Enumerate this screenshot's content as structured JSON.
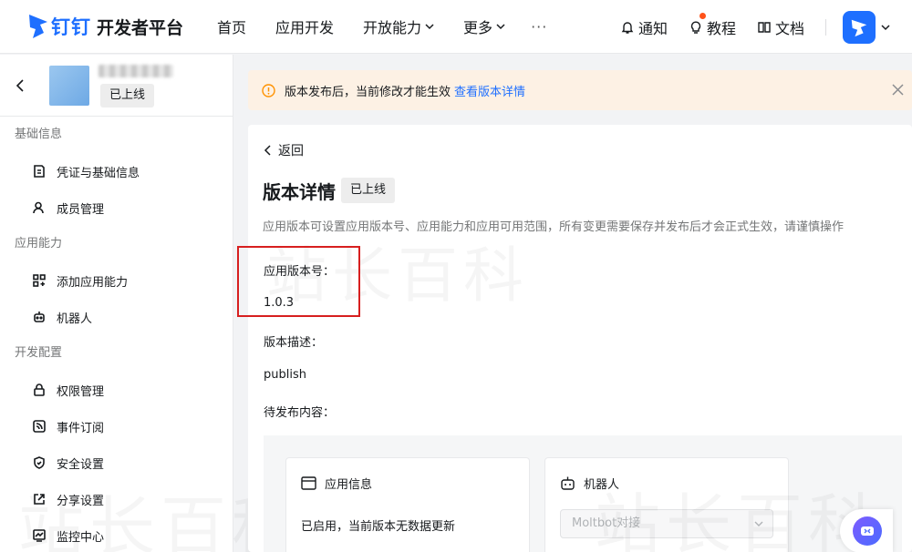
{
  "header": {
    "brand": "钉钉",
    "platform": "开发者平台",
    "nav": [
      "首页",
      "应用开发",
      "开放能力",
      "更多"
    ],
    "more_dots": "···",
    "notify": "通知",
    "tutorial": "教程",
    "docs": "文档",
    "brand_color": "#1e6fff"
  },
  "sidebar": {
    "app_status": "已上线",
    "groups": [
      {
        "title": "基础信息",
        "items": [
          "凭证与基础信息",
          "成员管理"
        ]
      },
      {
        "title": "应用能力",
        "items": [
          "添加应用能力",
          "机器人"
        ]
      },
      {
        "title": "开发配置",
        "items": [
          "权限管理",
          "事件订阅",
          "安全设置",
          "分享设置",
          "监控中心"
        ]
      }
    ]
  },
  "notice": {
    "text": "版本发布后，当前修改才能生效",
    "link": "查看版本详情",
    "bg_color": "#fdf1e4"
  },
  "detail": {
    "back": "返回",
    "title": "版本详情",
    "status": "已上线",
    "description": "应用版本可设置应用版本号、应用能力和应用可用范围，所有变更需要保存并发布后才会正式生效，请谨慎操作",
    "version_label": "应用版本号：",
    "version_value": "1.0.3",
    "desc_label": "版本描述：",
    "desc_value": "publish",
    "pending_label": "待发布内容：",
    "highlight_color": "#d71f1f"
  },
  "pending": {
    "app_info": {
      "title": "应用信息",
      "text": "已启用，当前版本无数据更新"
    },
    "robot": {
      "title": "机器人",
      "select_value": "Moltbot对接"
    }
  },
  "watermark": "站长百科"
}
